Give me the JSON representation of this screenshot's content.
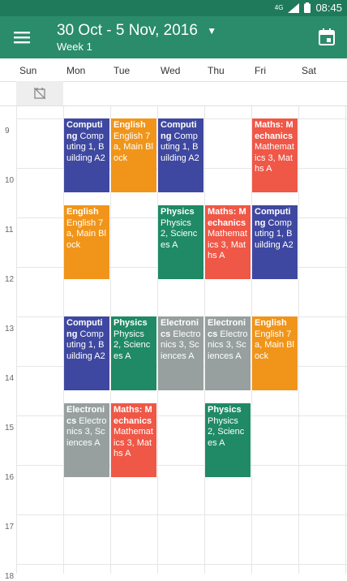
{
  "status": {
    "network": "4G",
    "time": "08:45"
  },
  "appbar": {
    "title": "30 Oct - 5 Nov, 2016",
    "subtitle": "Week 1"
  },
  "days": [
    "Sun",
    "Mon",
    "Tue",
    "Wed",
    "Thu",
    "Fri",
    "Sat"
  ],
  "hours": [
    "9",
    "10",
    "11",
    "12",
    "13",
    "14",
    "15",
    "16",
    "17",
    "18"
  ],
  "colors": {
    "primary": "#2a8c6a",
    "status": "#1f7a5c",
    "computing": "#3f48a0",
    "english": "#f0951a",
    "physics": "#1f8a65",
    "maths": "#ef5747",
    "electronics": "#979f9f"
  },
  "events": [
    {
      "day": 1,
      "start": 9.0,
      "end": 10.5,
      "color": "computing",
      "title": "Computing",
      "detail": "Computing 1, Building A2"
    },
    {
      "day": 2,
      "start": 9.0,
      "end": 10.5,
      "color": "english",
      "title": "English",
      "detail": "English 7a, Main Block"
    },
    {
      "day": 3,
      "start": 9.0,
      "end": 10.5,
      "color": "computing",
      "title": "Computing",
      "detail": "Computing 1, Building A2"
    },
    {
      "day": 5,
      "start": 9.0,
      "end": 10.5,
      "color": "maths",
      "title": "Maths: Mechanics",
      "detail": "Mathematics 3, Maths A"
    },
    {
      "day": 1,
      "start": 10.75,
      "end": 12.25,
      "color": "english",
      "title": "English",
      "detail": "English 7a, Main Block"
    },
    {
      "day": 3,
      "start": 10.75,
      "end": 12.25,
      "color": "physics",
      "title": "Physics",
      "detail": "Physics 2, Sciences A"
    },
    {
      "day": 4,
      "start": 10.75,
      "end": 12.25,
      "color": "maths",
      "title": "Maths: Mechanics",
      "detail": "Mathematics 3, Maths A"
    },
    {
      "day": 5,
      "start": 10.75,
      "end": 12.25,
      "color": "computing",
      "title": "Computing",
      "detail": "Computing 1, Building A2"
    },
    {
      "day": 1,
      "start": 13.0,
      "end": 14.5,
      "color": "computing",
      "title": "Computing",
      "detail": "Computing 1, Building A2"
    },
    {
      "day": 2,
      "start": 13.0,
      "end": 14.5,
      "color": "physics",
      "title": "Physics",
      "detail": "Physics 2, Sciences A"
    },
    {
      "day": 3,
      "start": 13.0,
      "end": 14.5,
      "color": "electronics",
      "title": "Electronics",
      "detail": "Electronics 3, Sciences A"
    },
    {
      "day": 4,
      "start": 13.0,
      "end": 14.5,
      "color": "electronics",
      "title": "Electronics",
      "detail": "Electronics 3, Sciences A"
    },
    {
      "day": 5,
      "start": 13.0,
      "end": 14.5,
      "color": "english",
      "title": "English",
      "detail": "English 7a, Main Block"
    },
    {
      "day": 1,
      "start": 14.75,
      "end": 16.25,
      "color": "electronics",
      "title": "Electronics",
      "detail": "Electronics 3, Sciences A"
    },
    {
      "day": 2,
      "start": 14.75,
      "end": 16.25,
      "color": "maths",
      "title": "Maths: Mechanics",
      "detail": "Mathematics 3, Maths A"
    },
    {
      "day": 4,
      "start": 14.75,
      "end": 16.25,
      "color": "physics",
      "title": "Physics",
      "detail": "Physics 2, Sciences A"
    }
  ]
}
